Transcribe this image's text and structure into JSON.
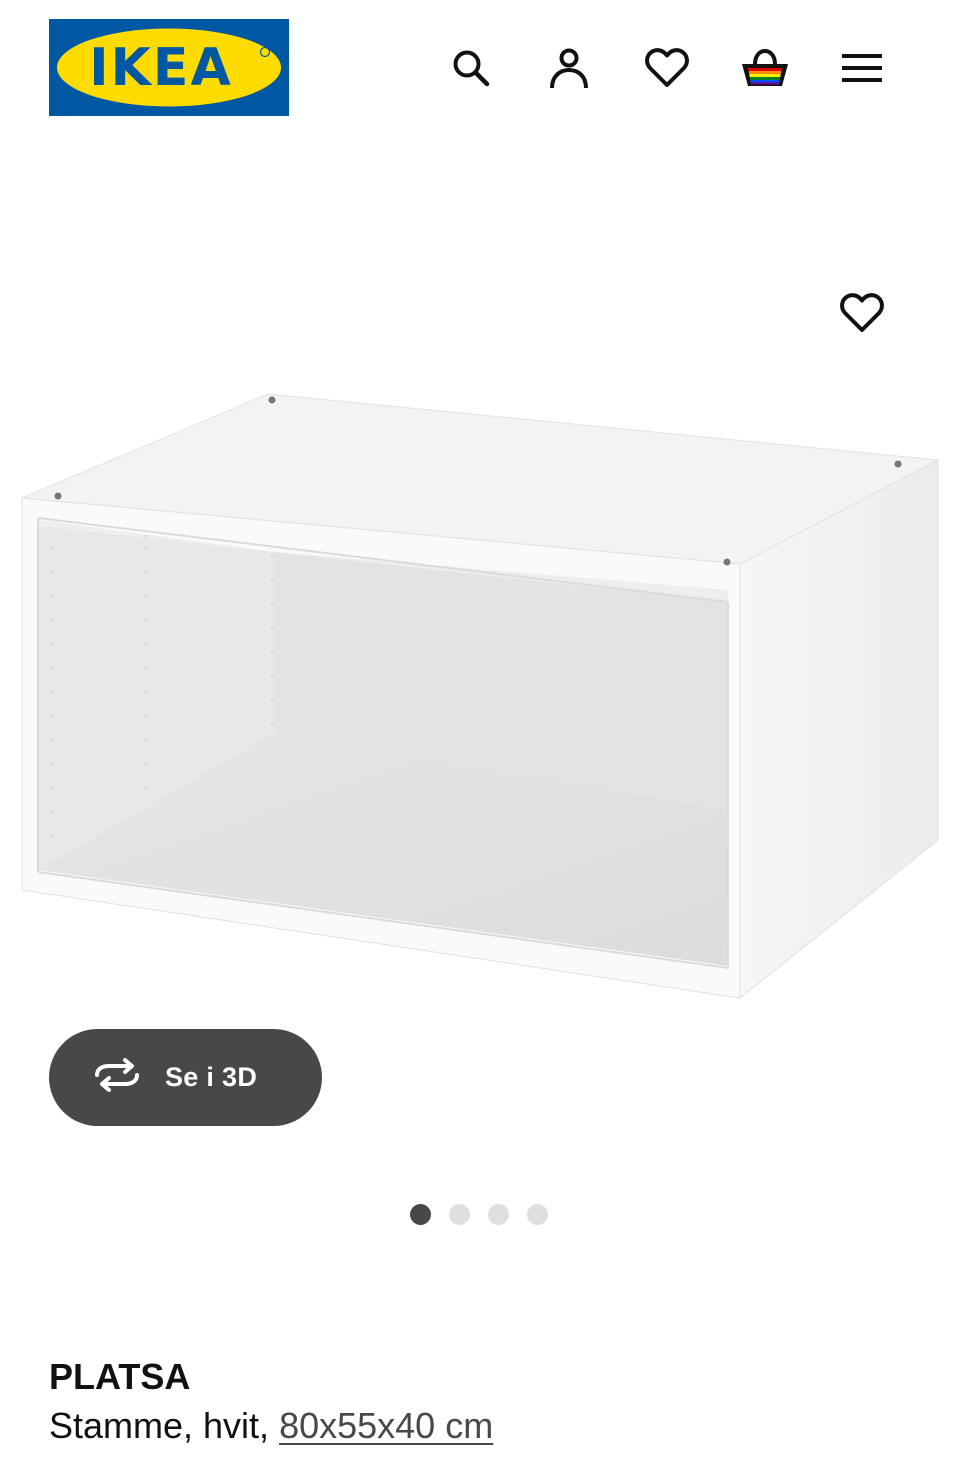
{
  "header": {
    "logo_text": "IKEA",
    "icons": [
      "search-icon",
      "profile-icon",
      "heart-icon",
      "shopping-basket-icon",
      "hamburger-menu-icon"
    ]
  },
  "gallery": {
    "favourite_icon": "heart-icon",
    "view_3d_label": "Se i 3D",
    "view_3d_icon": "rotate-3d-icon",
    "slide_count": 4,
    "active_slide": 1
  },
  "product": {
    "name": "PLATSA",
    "description": "Stamme, hvit,",
    "size": "80x55x40 cm"
  },
  "colors": {
    "brand_blue": "#0058a3",
    "brand_yellow": "#ffdb00",
    "dark_grey": "#484848",
    "light_grey": "#dfdfdf"
  }
}
